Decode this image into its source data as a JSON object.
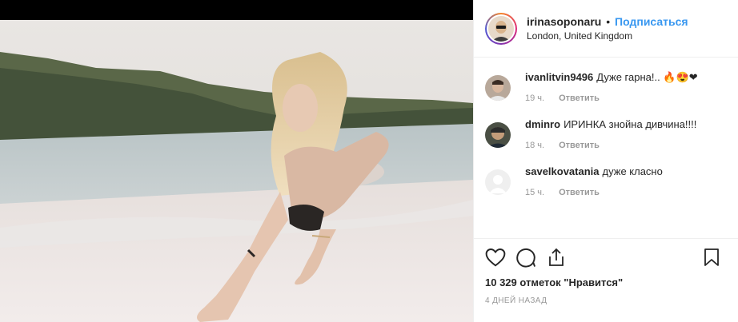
{
  "post": {
    "username": "irinasoponaru",
    "separator": "•",
    "follow_label": "Подписаться",
    "location": "London, United Kingdom"
  },
  "comments": [
    {
      "user": "ivanlitvin9496",
      "text": "Дуже гарна!.. 🔥😍❤",
      "time": "19 ч.",
      "reply": "Ответить"
    },
    {
      "user": "dminro",
      "text": "ИРИНКА знойна дивчина!!!!",
      "time": "18 ч.",
      "reply": "Ответить"
    },
    {
      "user": "savelkovatania",
      "text": "дуже класно",
      "time": "15 ч.",
      "reply": "Ответить"
    }
  ],
  "actions": {
    "like_icon": "heart-icon",
    "comment_icon": "comment-icon",
    "share_icon": "share-icon",
    "save_icon": "bookmark-icon"
  },
  "likes_text": "10 329 отметок \"Нравится\"",
  "posted_time": "4 дней назад",
  "colors": {
    "follow": "#3897f0",
    "meta_gray": "#999999",
    "border": "#efefef"
  }
}
